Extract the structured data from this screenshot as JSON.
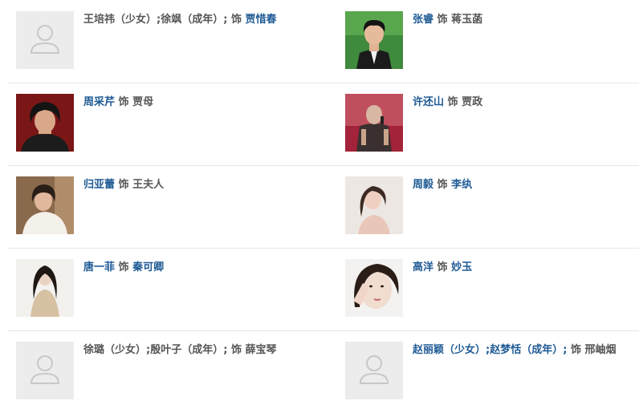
{
  "colors": {
    "link": "#1e5a94",
    "text": "#555555",
    "divider": "#e6e6e6",
    "placeholder": "#ececec"
  },
  "cast": [
    {
      "actor_plain": "王培祎（少女）;徐飒（成年）;",
      "actor_link": "",
      "as_label": "饰",
      "role_link": "贾惜春",
      "role_plain": "",
      "photo": "placeholder"
    },
    {
      "actor_plain": "",
      "actor_link": "张睿",
      "as_label": "饰",
      "role_link": "",
      "role_plain": "蒋玉菡",
      "photo": "portrait-young-man-dark-hair-green-background"
    },
    {
      "actor_plain": "",
      "actor_link": "周采芹",
      "as_label": "饰",
      "role_link": "",
      "role_plain": "贾母",
      "photo": "portrait-older-woman-dark-hair-red-background"
    },
    {
      "actor_plain": "",
      "actor_link": "许还山",
      "as_label": "饰",
      "role_link": "",
      "role_plain": "贾政",
      "photo": "portrait-older-man-singing-microphone-stage"
    },
    {
      "actor_plain": "",
      "actor_link": "归亚蕾",
      "as_label": "饰",
      "role_link": "",
      "role_plain": "王夫人",
      "photo": "portrait-woman-white-coat-beige"
    },
    {
      "actor_plain": "",
      "actor_link": "周毅",
      "as_label": "饰",
      "role_link": "李纨",
      "role_plain": "",
      "photo": "portrait-woman-long-hair-pale-background"
    },
    {
      "actor_plain": "",
      "actor_link": "唐一菲",
      "as_label": "饰",
      "role_link": "秦可卿",
      "role_plain": "",
      "photo": "portrait-woman-gold-dress-white-background"
    },
    {
      "actor_plain": "",
      "actor_link": "高洋",
      "as_label": "饰",
      "role_link": "妙玉",
      "role_plain": "",
      "photo": "portrait-woman-hand-on-face-close-up"
    },
    {
      "actor_plain": "徐璐（少女）;殷叶子（成年）;",
      "actor_link": "",
      "as_label": "饰",
      "role_link": "",
      "role_plain": "薛宝琴",
      "photo": "placeholder"
    },
    {
      "actor_plain": "",
      "actor_link": "赵丽颖（少女）;赵梦恬（成年）;",
      "as_label": "饰",
      "role_link": "",
      "role_plain": "邢岫烟",
      "photo": "placeholder"
    }
  ]
}
